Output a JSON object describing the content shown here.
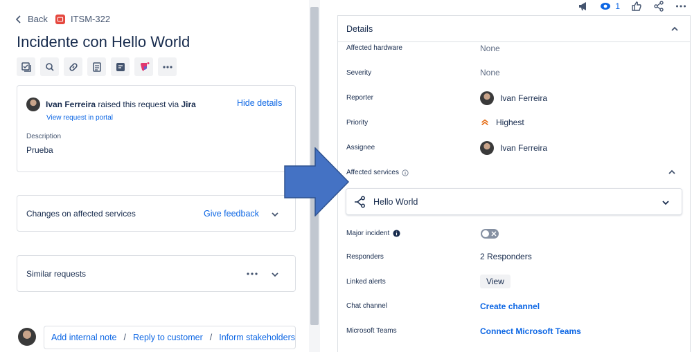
{
  "nav": {
    "back_label": "Back",
    "issue_key": "ITSM-322"
  },
  "issue": {
    "title": "Incidente con Hello World"
  },
  "request": {
    "reporter_name": "Ivan Ferreira",
    "raised_text": "raised this request via",
    "channel": "Jira",
    "hide_details": "Hide details",
    "view_portal": "View request in portal",
    "description_label": "Description",
    "description_value": "Prueba"
  },
  "changes_card": {
    "title": "Changes on affected services",
    "feedback": "Give feedback"
  },
  "similar_card": {
    "title": "Similar requests"
  },
  "comment": {
    "internal_note": "Add internal note",
    "sep1": "/",
    "reply": "Reply to customer",
    "sep2": "/",
    "inform": "Inform stakeholders"
  },
  "top": {
    "watch_count": "1"
  },
  "details": {
    "title": "Details",
    "affected_hardware": {
      "label": "Affected hardware",
      "value": "None"
    },
    "severity": {
      "label": "Severity",
      "value": "None"
    },
    "reporter": {
      "label": "Reporter",
      "value": "Ivan Ferreira"
    },
    "priority": {
      "label": "Priority",
      "value": "Highest"
    },
    "assignee": {
      "label": "Assignee",
      "value": "Ivan Ferreira"
    },
    "affected_services": {
      "label": "Affected services",
      "service": "Hello World"
    },
    "major_incident": {
      "label": "Major incident"
    },
    "responders": {
      "label": "Responders",
      "value": "2 Responders"
    },
    "linked_alerts": {
      "label": "Linked alerts",
      "button": "View"
    },
    "chat_channel": {
      "label": "Chat channel",
      "link": "Create channel"
    },
    "microsoft_teams": {
      "label": "Microsoft Teams",
      "link": "Connect Microsoft Teams"
    }
  },
  "colors": {
    "link": "#0c66e4",
    "arrow": "#4472c4",
    "priority": "#e56910",
    "badge": "#e5483f"
  }
}
